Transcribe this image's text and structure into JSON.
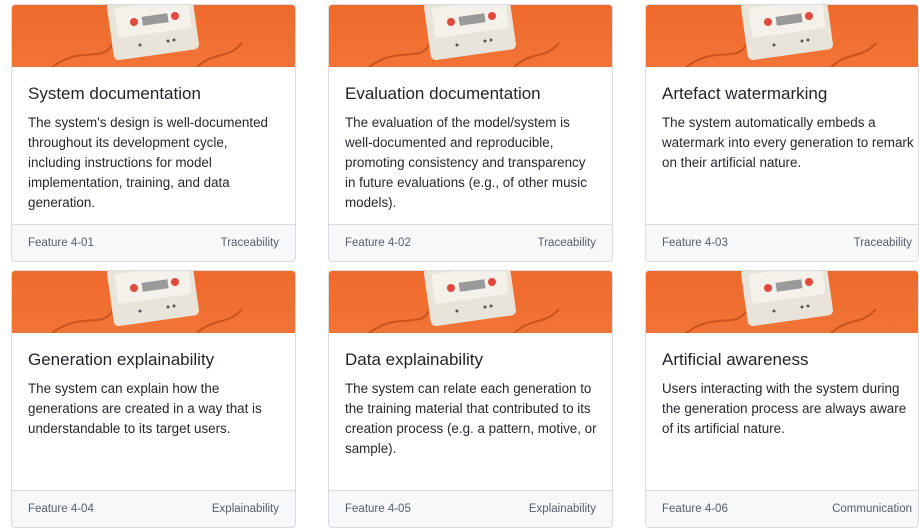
{
  "cards": [
    {
      "title": "System documentation",
      "description": "The system's design is well-documented throughout its development cycle, including instructions for model implementation, training, and data generation.",
      "feature_id": "Feature 4-01",
      "category": "Traceability"
    },
    {
      "title": "Evaluation documentation",
      "description": "The evaluation of the model/system is well-documented and reproducible, promoting consistency and transparency in future evaluations (e.g., of other music models).",
      "feature_id": "Feature 4-02",
      "category": "Traceability"
    },
    {
      "title": "Artefact watermarking",
      "description": "The system automatically embeds a watermark into every generation to remark on their artificial nature.",
      "feature_id": "Feature 4-03",
      "category": "Traceability"
    },
    {
      "title": "Generation explainability",
      "description": "The system can explain how the generations are created in a way that is understandable to its target users.",
      "feature_id": "Feature 4-04",
      "category": "Explainability"
    },
    {
      "title": "Data explainability",
      "description": "The system can relate each generation to the training material that contributed to its creation process (e.g. a pattern, motive, or sample).",
      "feature_id": "Feature 4-05",
      "category": "Explainability"
    },
    {
      "title": "Artificial awareness",
      "description": "Users interacting with the system during the generation process are always aware of its artificial nature.",
      "feature_id": "Feature 4-06",
      "category": "Communication"
    }
  ],
  "banner": {
    "image": "cassette-tape-on-orange-background",
    "color": "#ef6a2c"
  }
}
